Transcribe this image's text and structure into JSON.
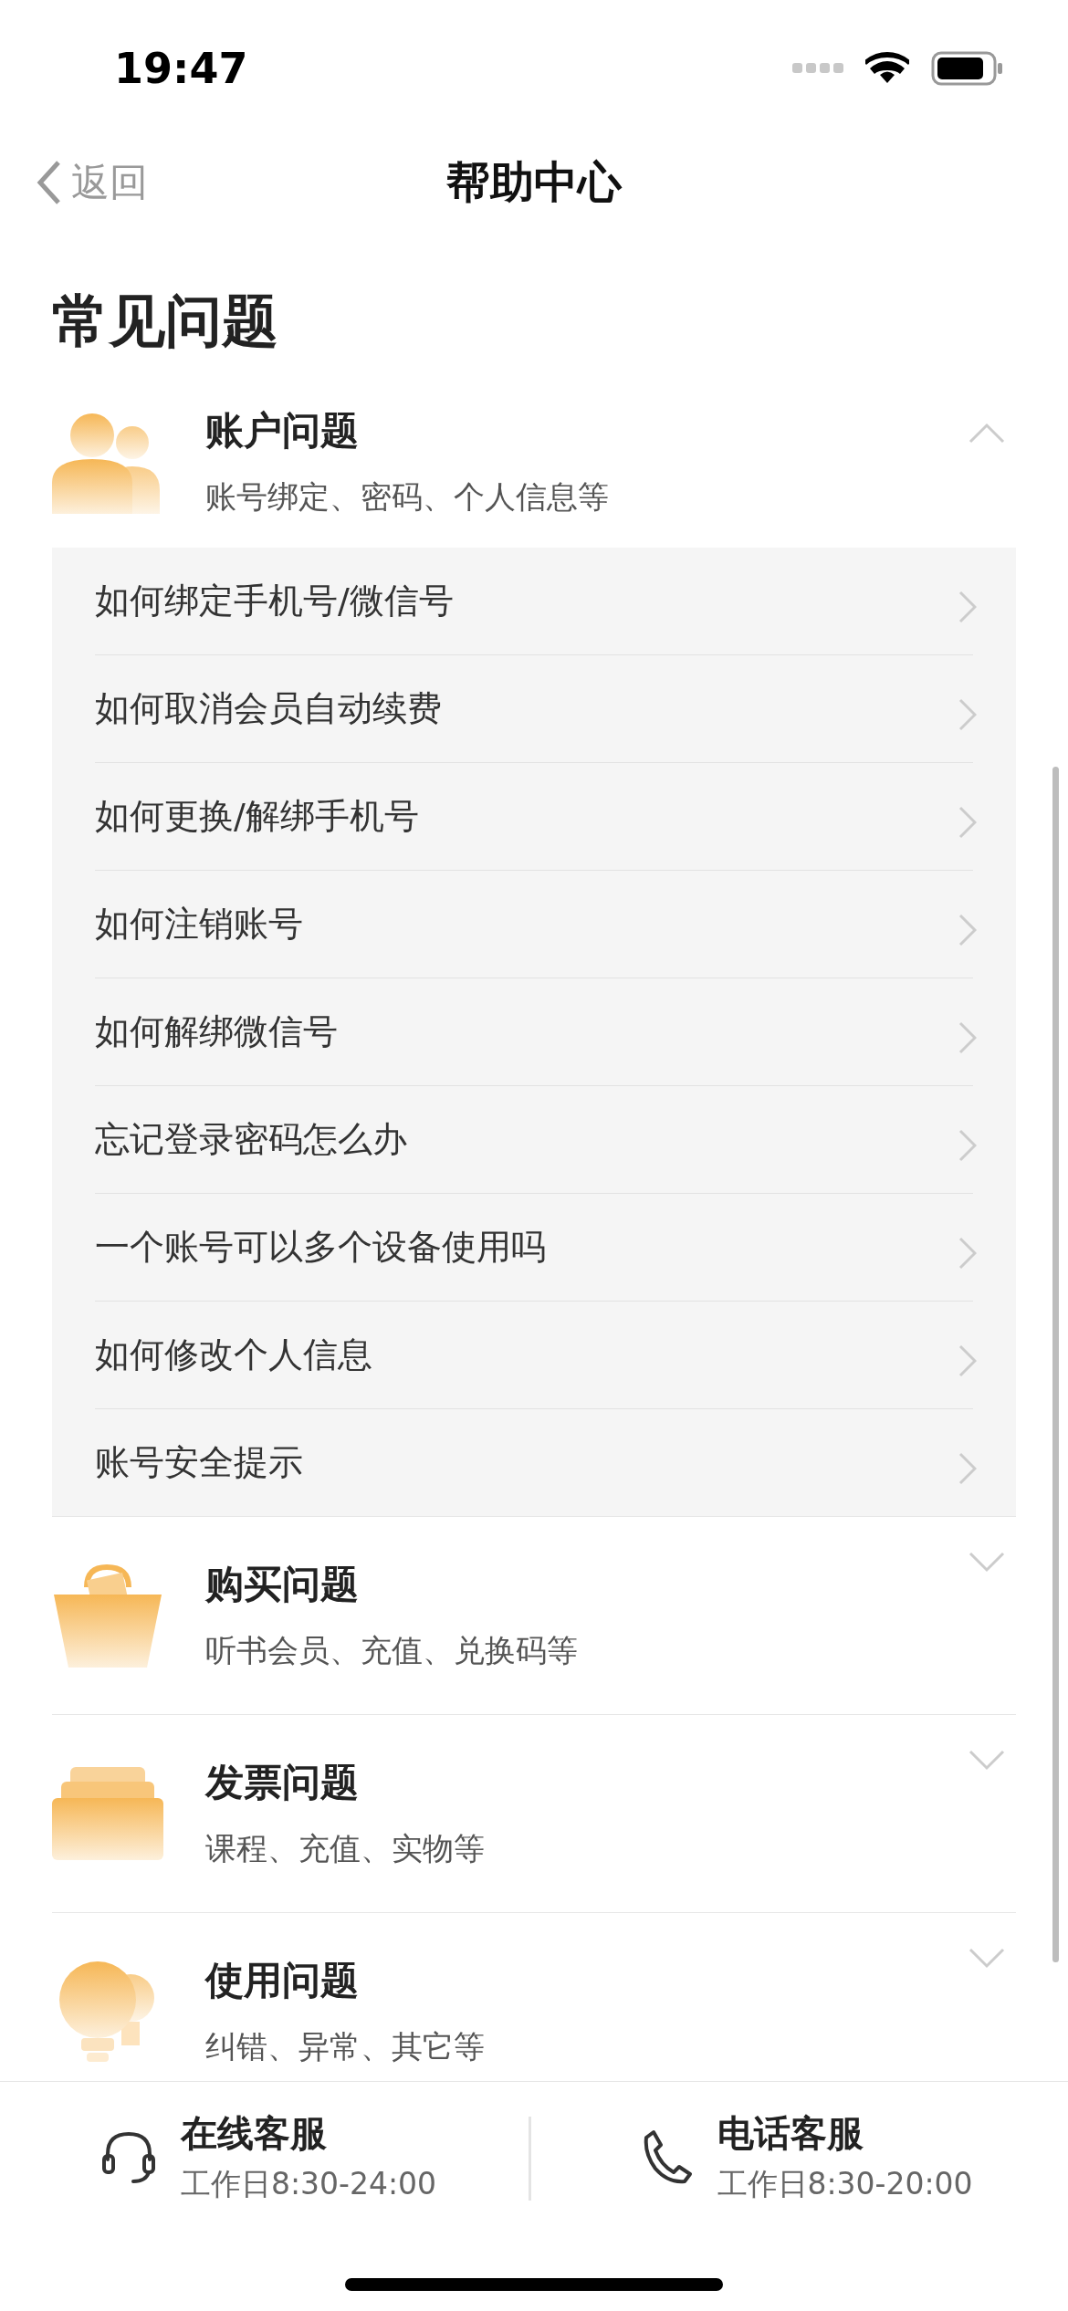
{
  "status_bar": {
    "time": "19:47"
  },
  "nav": {
    "back_label": "返回",
    "title": "帮助中心"
  },
  "heading": "常见问题",
  "categories": [
    {
      "kind": "account",
      "title": "账户问题",
      "subtitle": "账号绑定、密码、个人信息等",
      "expanded": true,
      "questions": [
        "如何绑定手机号/微信号",
        "如何取消会员自动续费",
        "如何更换/解绑手机号",
        "如何注销账号",
        "如何解绑微信号",
        "忘记登录密码怎么办",
        "一个账号可以多个设备使用吗",
        "如何修改个人信息",
        "账号安全提示"
      ]
    },
    {
      "kind": "purchase",
      "title": "购买问题",
      "subtitle": "听书会员、充值、兑换码等",
      "expanded": false
    },
    {
      "kind": "invoice",
      "title": "发票问题",
      "subtitle": "课程、充值、实物等",
      "expanded": false
    },
    {
      "kind": "usage",
      "title": "使用问题",
      "subtitle": "纠错、异常、其它等",
      "expanded": false
    }
  ],
  "footer": [
    {
      "kind": "chat",
      "title": "在线客服",
      "hours": "工作日8:30-24:00"
    },
    {
      "kind": "phone",
      "title": "电话客服",
      "hours": "工作日8:30-20:00"
    }
  ]
}
